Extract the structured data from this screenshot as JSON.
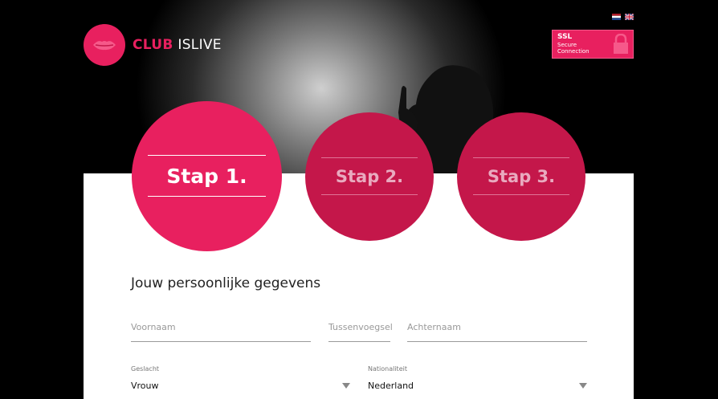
{
  "brand": {
    "club": "CLUB",
    "name": "ISLIVE"
  },
  "ssl": {
    "title": "SSL",
    "line1": "Secure",
    "line2": "Connection"
  },
  "steps": [
    {
      "label": "Stap 1.",
      "active": true
    },
    {
      "label": "Stap 2.",
      "active": false
    },
    {
      "label": "Stap 3.",
      "active": false
    }
  ],
  "form": {
    "title": "Jouw persoonlijke gegevens",
    "voornaam_placeholder": "Voornaam",
    "tussenvoegsel_placeholder": "Tussenvoegsel",
    "achternaam_placeholder": "Achternaam",
    "geslacht_label": "Geslacht",
    "geslacht_value": "Vrouw",
    "nationaliteit_label": "Nationaliteit",
    "nationaliteit_value": "Nederland"
  },
  "colors": {
    "accent": "#e8205f",
    "accent_dark": "#c4174a"
  },
  "icons": [
    "lips-logo-icon",
    "nl-flag-icon",
    "uk-flag-icon",
    "lock-icon",
    "chevron-down-icon"
  ]
}
